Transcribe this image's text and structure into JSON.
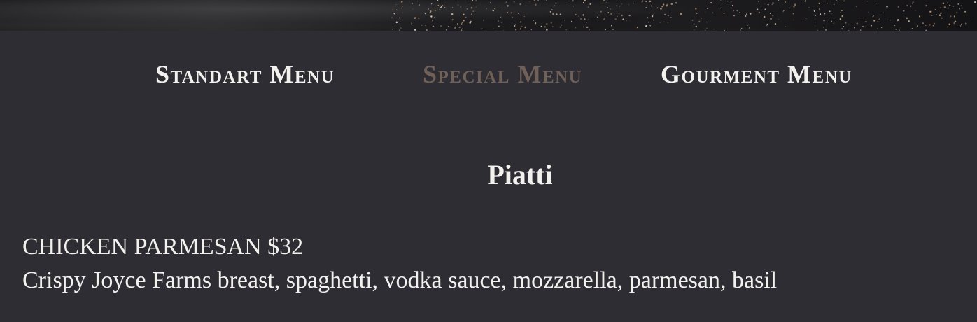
{
  "menu_tabs": [
    {
      "label": "Standart Menu",
      "active": false
    },
    {
      "label": "Special Menu",
      "active": true
    },
    {
      "label": "Gourment Menu",
      "active": false
    }
  ],
  "section": {
    "title": "Piatti"
  },
  "items": [
    {
      "name": "CHICKEN PARMESAN",
      "price": "$32",
      "description": "Crispy Joyce Farms breast, spaghetti, vodka sauce, mozzarella, parmesan, basil"
    }
  ],
  "colors": {
    "background": "#2e2d33",
    "text": "#f3f1ee",
    "active_tab": "#6f6058"
  }
}
